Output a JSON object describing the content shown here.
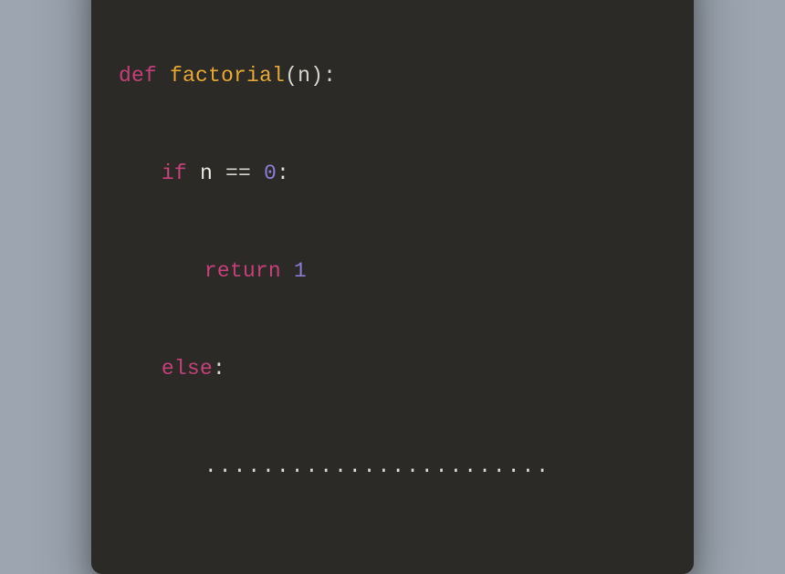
{
  "colors": {
    "background": "#9ca5b0",
    "window_bg": "#2b2a26",
    "traffic_close": "#ff5f56",
    "traffic_min": "#ffbd2e",
    "traffic_max": "#27c93f",
    "keyword": "#c5407a",
    "funcname": "#e6a833",
    "number": "#8b7dd8",
    "default_text": "#e8e6e1"
  },
  "code": {
    "line1": {
      "keyword": "def",
      "space1": " ",
      "funcname": "factorial",
      "lparen": "(",
      "param": "n",
      "rparen": ")",
      "colon": ":"
    },
    "line2": {
      "keyword": "if",
      "space1": " ",
      "var": "n",
      "space2": " ",
      "op": "==",
      "space3": " ",
      "number": "0",
      "colon": ":"
    },
    "line3": {
      "keyword": "return",
      "space1": " ",
      "number": "1"
    },
    "line4": {
      "keyword": "else",
      "colon": ":"
    },
    "line5": {
      "dots": "........................"
    }
  }
}
